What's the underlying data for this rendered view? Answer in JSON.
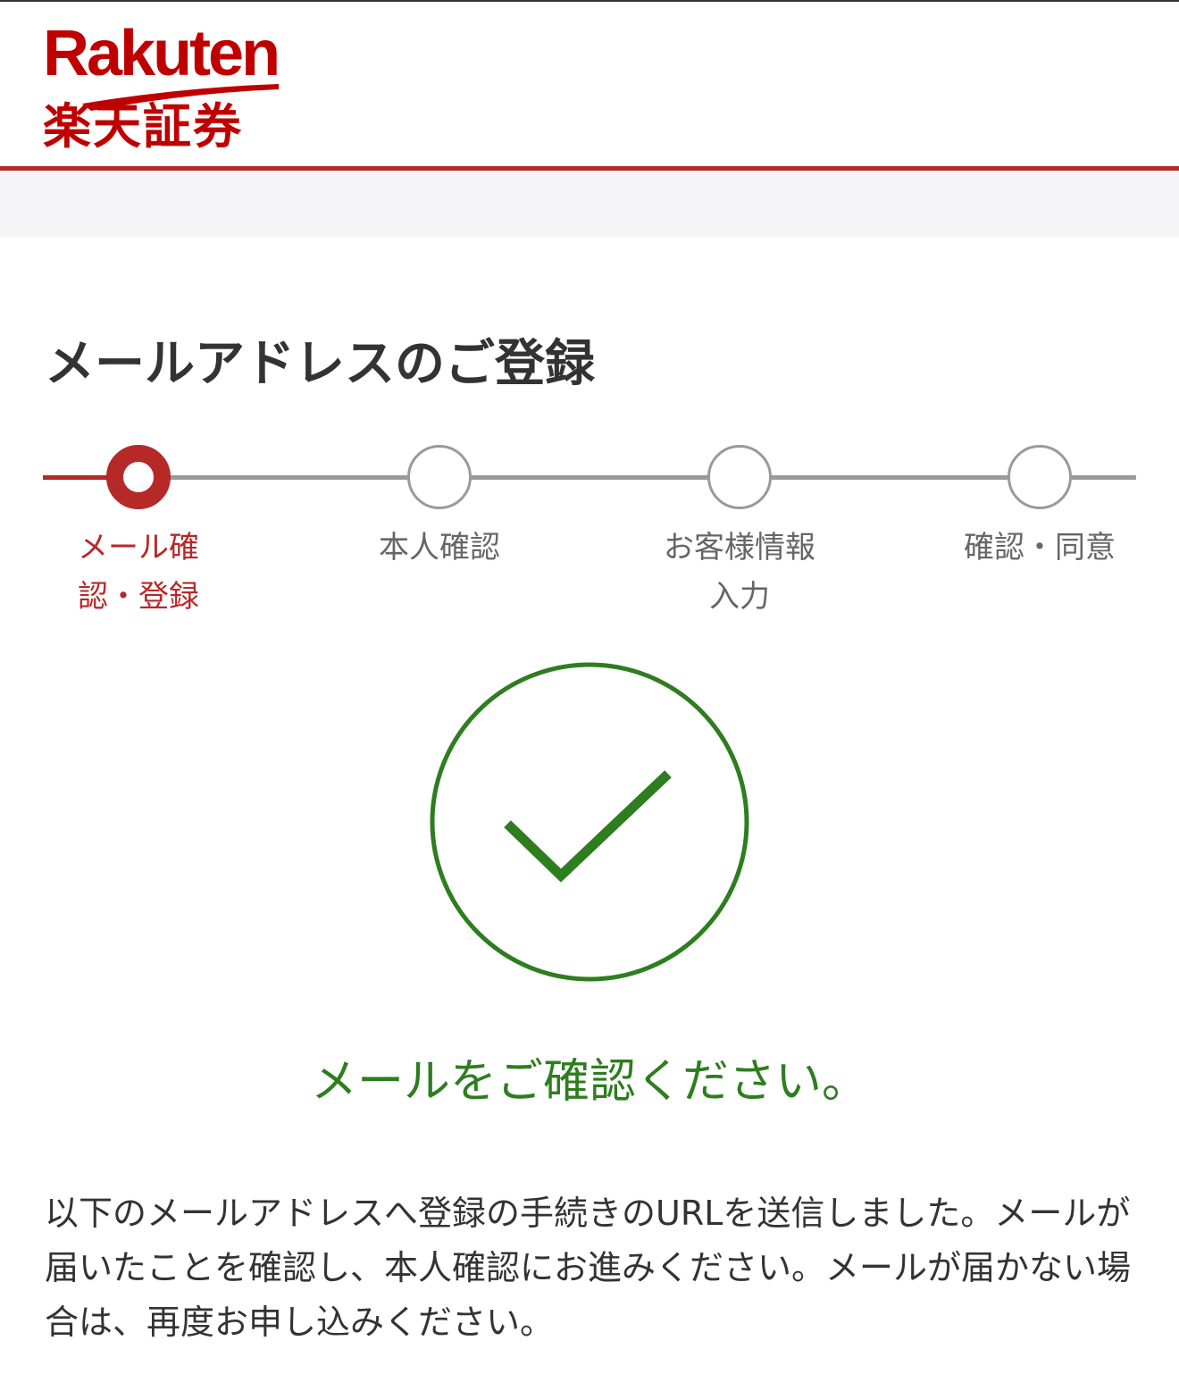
{
  "header": {
    "logo_en": "Rakuten",
    "logo_jp": "楽天証券",
    "brand_color": "#bf0000"
  },
  "page_title": "メールアドレスのご登録",
  "stepper": {
    "active_color": "#b52929",
    "inactive_color": "#9a9a9a",
    "current_step": 1,
    "steps": [
      {
        "label_line1": "メール確",
        "label_line2": "認・登録",
        "state": "active"
      },
      {
        "label_line1": "本人確認",
        "label_line2": "",
        "state": "pending"
      },
      {
        "label_line1": "お客様情報",
        "label_line2": "入力",
        "state": "pending"
      },
      {
        "label_line1": "確認・同意",
        "label_line2": "",
        "state": "pending"
      }
    ]
  },
  "success": {
    "icon": "check-circle-icon",
    "color": "#2e7d1f",
    "message": "メールをご確認ください。"
  },
  "body_text": "以下のメールアドレスへ登録の手続きのURLを送信しました。メールが届いたことを確認し、本人確認にお進みください。メールが届かない場合は、再度お申し込みください。"
}
